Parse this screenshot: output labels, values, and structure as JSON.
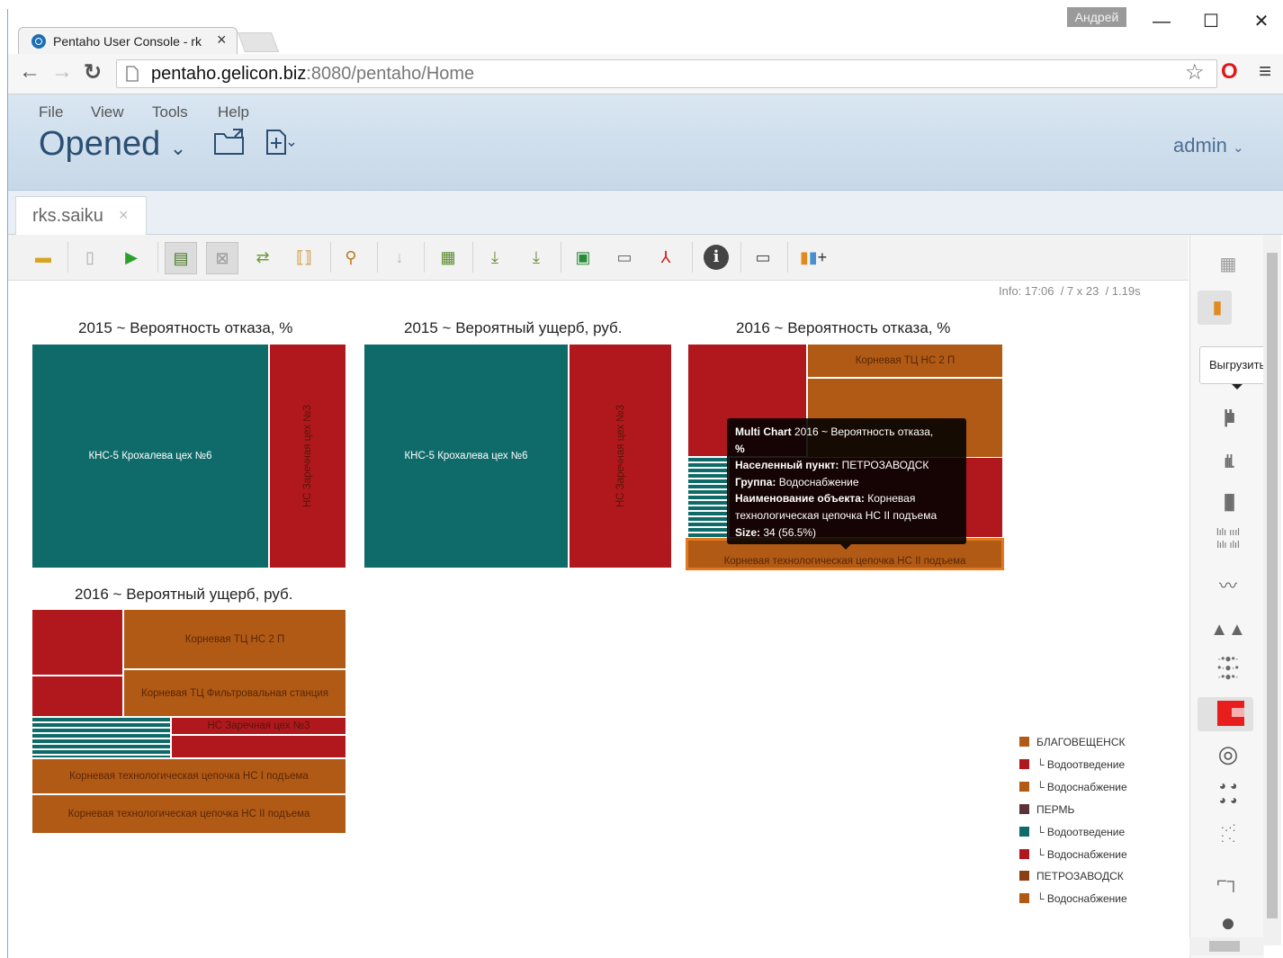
{
  "browser": {
    "user_badge": "Андрей",
    "tab_title": "Pentaho User Console - rk",
    "tab_close": "×",
    "url_host": "pentaho.gelicon.biz",
    "url_rest": ":8080/pentaho/Home",
    "controls": {
      "minimize": "—",
      "maximize": "☐",
      "close": "✕"
    }
  },
  "app": {
    "menu": [
      "File",
      "View",
      "Tools",
      "Help"
    ],
    "perspective": "Opened",
    "user": "admin"
  },
  "document_tab": {
    "label": "rks.saiku",
    "close": "×"
  },
  "info": {
    "label": "Info:",
    "time": "17:06",
    "dims": "/ 7 x 23",
    "duration": "/ 1.19s"
  },
  "sidebar": {
    "export_tooltip": "Выгрузить"
  },
  "colors": {
    "teal": "#0f6b69",
    "red": "#b0181e",
    "orange": "#b15a16",
    "brown": "#8a3e14",
    "purple": "#5a3237"
  },
  "charts": [
    {
      "title": "2015 ~ Вероятность отказа, %",
      "cells": [
        {
          "label": "КНС-5 Крохалева цех №6",
          "color": "#0f6b69"
        },
        {
          "label": "НС Заречная цех №3",
          "color": "#b0181e"
        }
      ]
    },
    {
      "title": "2015 ~ Вероятный ущерб, руб.",
      "cells": [
        {
          "label": "КНС-5 Крохалева цех №6",
          "color": "#0f6b69"
        },
        {
          "label": "НС Заречная цех №3",
          "color": "#b0181e"
        }
      ]
    },
    {
      "title": "2016 ~ Вероятность отказа, %",
      "cells": [
        {
          "label": "Корневая ТЦ НС 2 П",
          "color": "#b15a16"
        },
        {
          "label": "Корневая технологическая цепочка НС II подъема",
          "color": "#b15a16"
        }
      ]
    },
    {
      "title": "2016 ~ Вероятный ущерб, руб.",
      "cells": [
        {
          "label": "Корневая ТЦ НС 2 П",
          "color": "#b15a16"
        },
        {
          "label": "Корневая ТЦ Фильтровальная станция",
          "color": "#b15a16"
        },
        {
          "label": "НС Заречная цех №3",
          "color": "#b0181e"
        },
        {
          "label": "Корневая технологическая цепочка НС I подъема",
          "color": "#b15a16"
        },
        {
          "label": "Корневая технологическая цепочка НС II подъема",
          "color": "#b15a16"
        }
      ]
    }
  ],
  "tooltip": {
    "line1_key": "Multi Chart",
    "line1_val": " 2016 ~ Вероятность отказа,",
    "line2": "%",
    "line3_key": "Населенный пункт:",
    "line3_val": " ПЕТРОЗАВОДСК",
    "line4_key": "Группа:",
    "line4_val": " Водоснабжение",
    "line5_key": "Наименование объекта:",
    "line5_val": " Корневая",
    "line6": "технологическая цепочка НС II подъема",
    "line7_key": "Size:",
    "line7_val": " 34 (56.5%)"
  },
  "legend": [
    {
      "label": "БЛАГОВЕЩЕНСК",
      "color": "#b15a16"
    },
    {
      "label": "└ Водоотведение",
      "color": "#b0181e"
    },
    {
      "label": "└ Водоснабжение",
      "color": "#b15a16"
    },
    {
      "label": "ПЕРМЬ",
      "color": "#5a3237"
    },
    {
      "label": "└ Водоотведение",
      "color": "#0f6b69"
    },
    {
      "label": "└ Водоснабжение",
      "color": "#b0181e"
    },
    {
      "label": "ПЕТРОЗАВОДСК",
      "color": "#8a3e14"
    },
    {
      "label": "└ Водоснабжение",
      "color": "#b15a16"
    }
  ]
}
